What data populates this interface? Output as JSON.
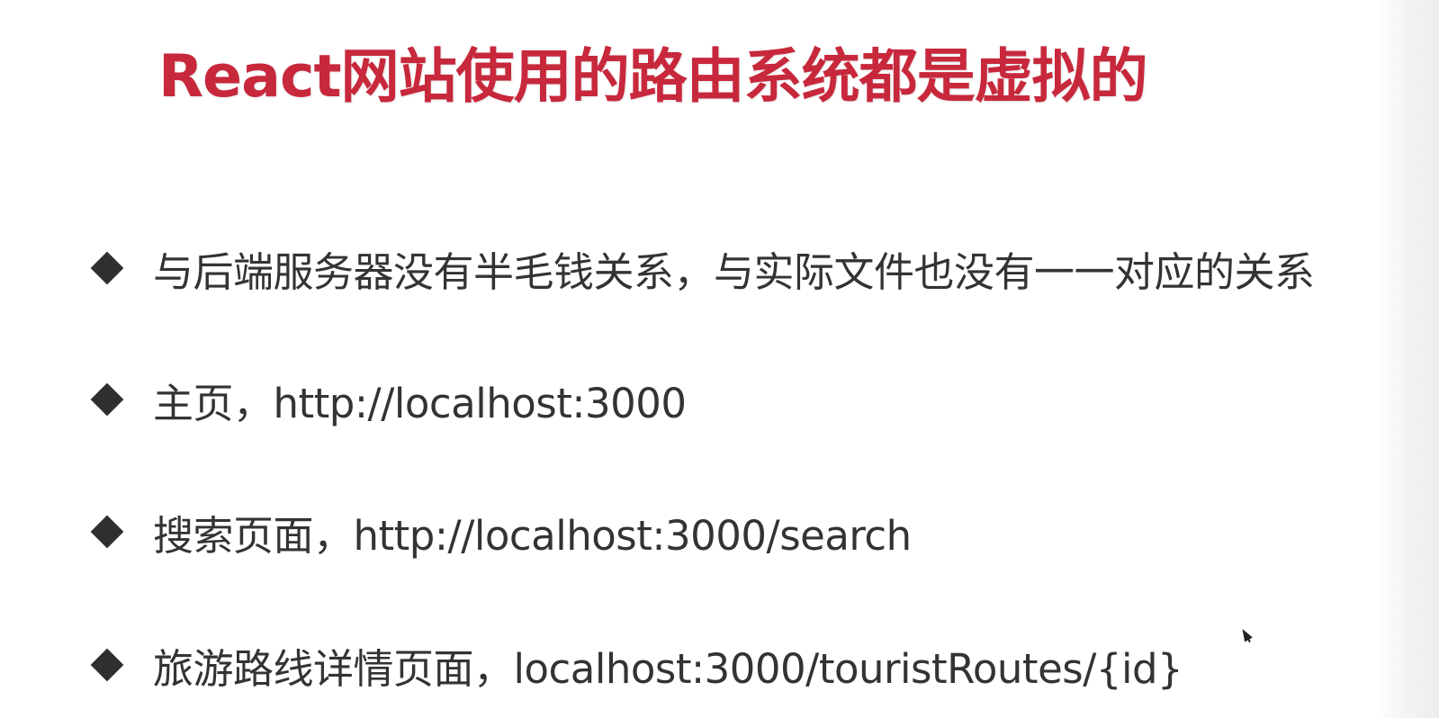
{
  "slide": {
    "title": "React网站使用的路由系统都是虚拟的",
    "title_color": "#c8283c",
    "bullet_marker": "diamond-bullet-icon",
    "bullets": [
      "与后端服务器没有半毛钱关系，与实际文件也没有一一对应的关系",
      "主页，http://localhost:3000",
      "搜索页面，http://localhost:3000/search",
      "旅游路线详情页面，localhost:3000/touristRoutes/{id}"
    ]
  }
}
